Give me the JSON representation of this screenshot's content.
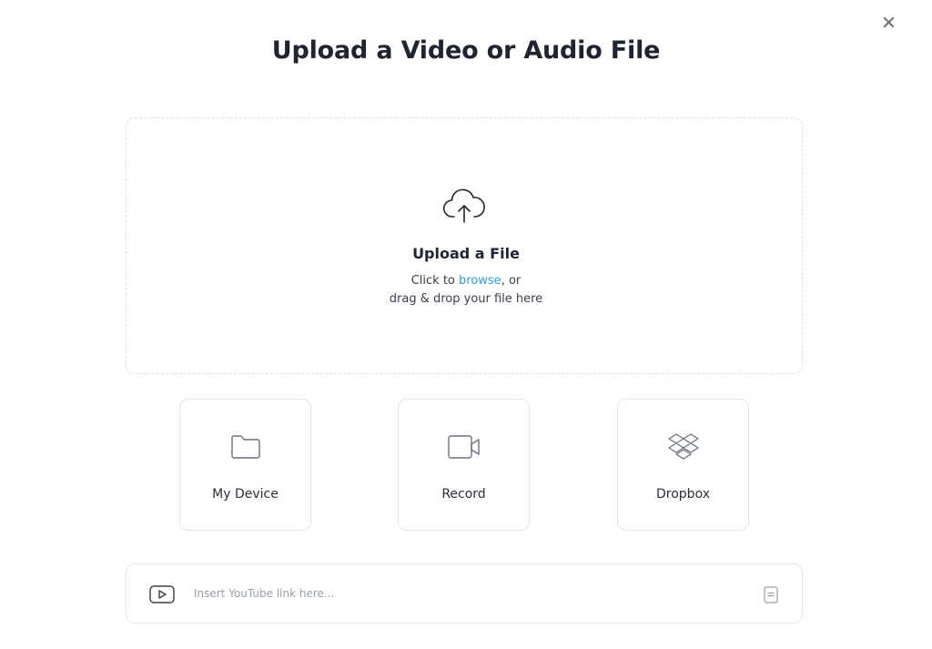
{
  "modal": {
    "title": "Upload a Video or Audio File",
    "close_icon": "close-icon"
  },
  "dropzone": {
    "icon": "cloud-upload-icon",
    "heading": "Upload a File",
    "hint_prefix": "Click to ",
    "browse_label": "browse",
    "hint_suffix": ", or",
    "hint_line2": "drag & drop your file here"
  },
  "sources": [
    {
      "label": "My Device",
      "icon": "folder-icon"
    },
    {
      "label": "Record",
      "icon": "video-camera-icon"
    },
    {
      "label": "Dropbox",
      "icon": "dropbox-icon"
    }
  ],
  "youtube": {
    "icon": "youtube-play-icon",
    "placeholder": "Insert YouTube link here...",
    "value": "",
    "paste_icon": "clipboard-icon"
  },
  "colors": {
    "text": "#1f2433",
    "link": "#2f9de8",
    "border": "#e1e4e8",
    "placeholder": "#9aa0aa"
  }
}
